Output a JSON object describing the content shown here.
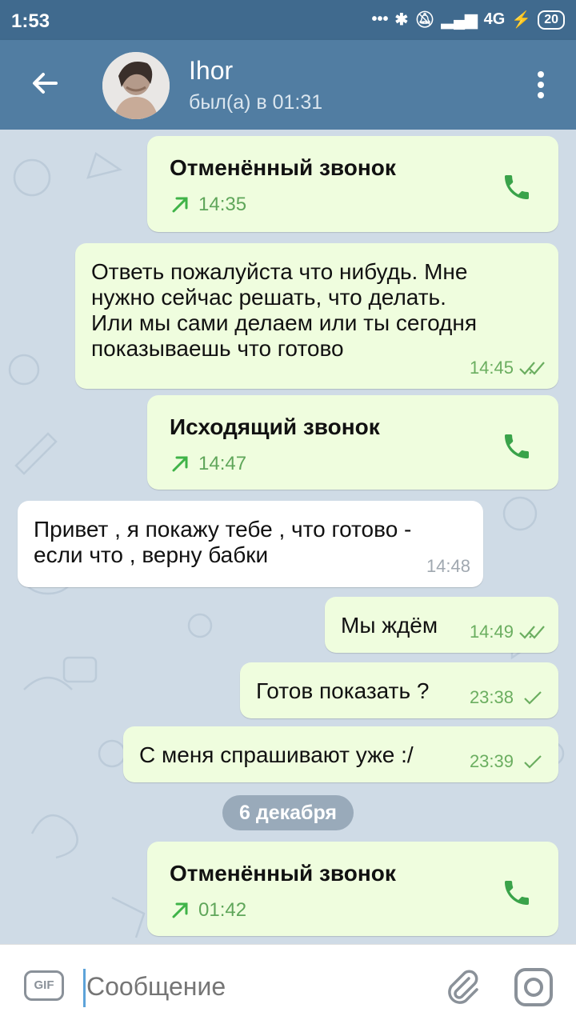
{
  "status_bar": {
    "time": "1:53",
    "network": "4G",
    "battery": "20"
  },
  "header": {
    "name": "Ihor",
    "status": "был(а) в 01:31"
  },
  "messages": [
    {
      "kind": "call",
      "title": "Отменённый звонок",
      "time": "14:35"
    },
    {
      "kind": "text",
      "lines": [
        "Ответь пожалуйста что нибудь. Мне",
        "нужно сейчас решать, что делать.",
        "Или мы сами делаем или ты сегодня",
        "показываешь что готово"
      ],
      "time": "14:45",
      "status": "read"
    },
    {
      "kind": "call",
      "title": "Исходящий звонок",
      "time": "14:47"
    },
    {
      "kind": "text",
      "incoming": true,
      "lines": [
        "Привет , я покажу тебе , что готово -",
        "если что , верну бабки"
      ],
      "time": "14:48"
    },
    {
      "kind": "text",
      "lines": [
        "Мы ждём"
      ],
      "time": "14:49",
      "status": "read"
    },
    {
      "kind": "text",
      "lines": [
        "Готов показать ?"
      ],
      "time": "23:38",
      "status": "sent"
    },
    {
      "kind": "text",
      "lines": [
        "С меня спрашивают уже :/"
      ],
      "time": "23:39",
      "status": "sent"
    },
    {
      "kind": "call",
      "title": "Отменённый звонок",
      "time": "01:42"
    }
  ],
  "date_divider": "6 декабря",
  "input": {
    "placeholder": "Сообщение",
    "gif_label": "GIF"
  },
  "colors": {
    "header": "#517da2",
    "status_bar": "#406a8e",
    "outgoing_bubble": "#effdde",
    "incoming_bubble": "#ffffff",
    "accent_green": "#5fa65a",
    "background": "#cfdbe6"
  },
  "icons": [
    "back-arrow-icon",
    "more-vert-icon",
    "phone-icon",
    "outgoing-arrow-icon",
    "double-check-icon",
    "single-check-icon",
    "attach-icon",
    "camera-icon",
    "bluetooth-icon",
    "mute-icon",
    "signal-icon",
    "charging-icon"
  ]
}
